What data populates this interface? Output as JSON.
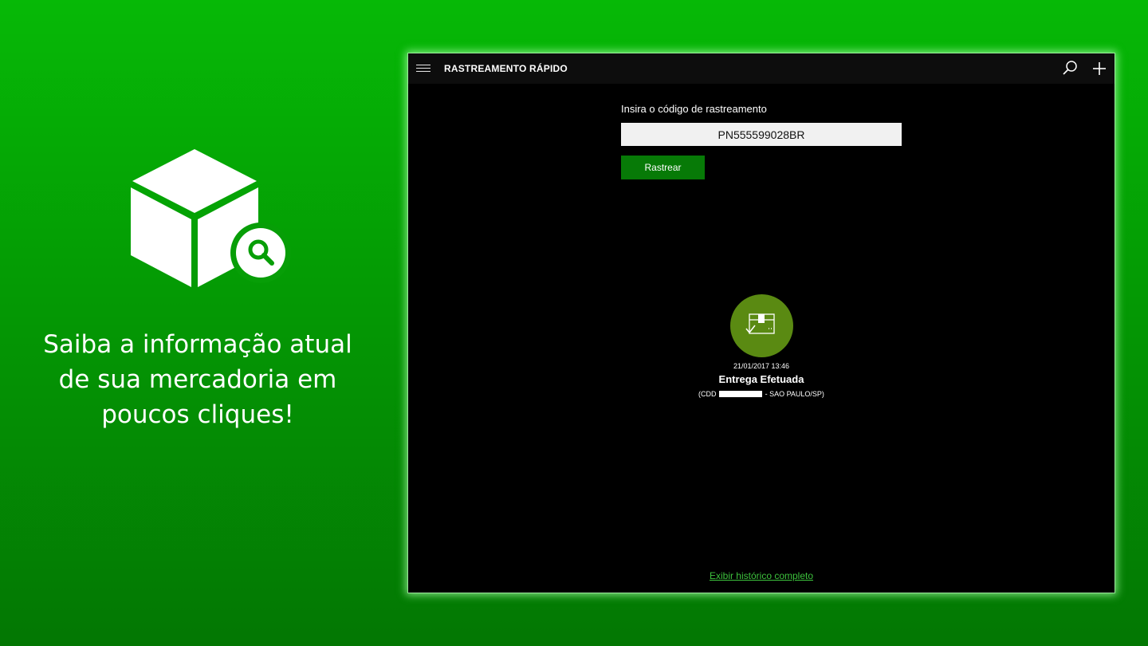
{
  "promo": {
    "icon": "package-search-icon",
    "text": "Saiba a informação atual de sua mercadoria em poucos cliques!"
  },
  "app": {
    "title": "RASTREAMENTO RÁPIDO",
    "toolbar_icons": [
      "hamburger-menu-icon",
      "search-icon",
      "plus-icon"
    ],
    "form": {
      "label": "Insira o código de rastreamento",
      "tracking_code": "PN555599028BR",
      "button_label": "Rastrear"
    },
    "status": {
      "icon": "package-delivered-icon",
      "datetime": "21/01/2017 13:46",
      "title": "Entrega Efetuada",
      "location_prefix": "(CDD",
      "location_suffix": "- SAO PAULO/SP)"
    },
    "history_link": "Exibir histórico completo"
  },
  "colors": {
    "background_top": "#06b906",
    "background_bottom": "#037703",
    "accent": "#077a07",
    "status_circle": "#5a8a12",
    "link": "#3dc23d"
  }
}
